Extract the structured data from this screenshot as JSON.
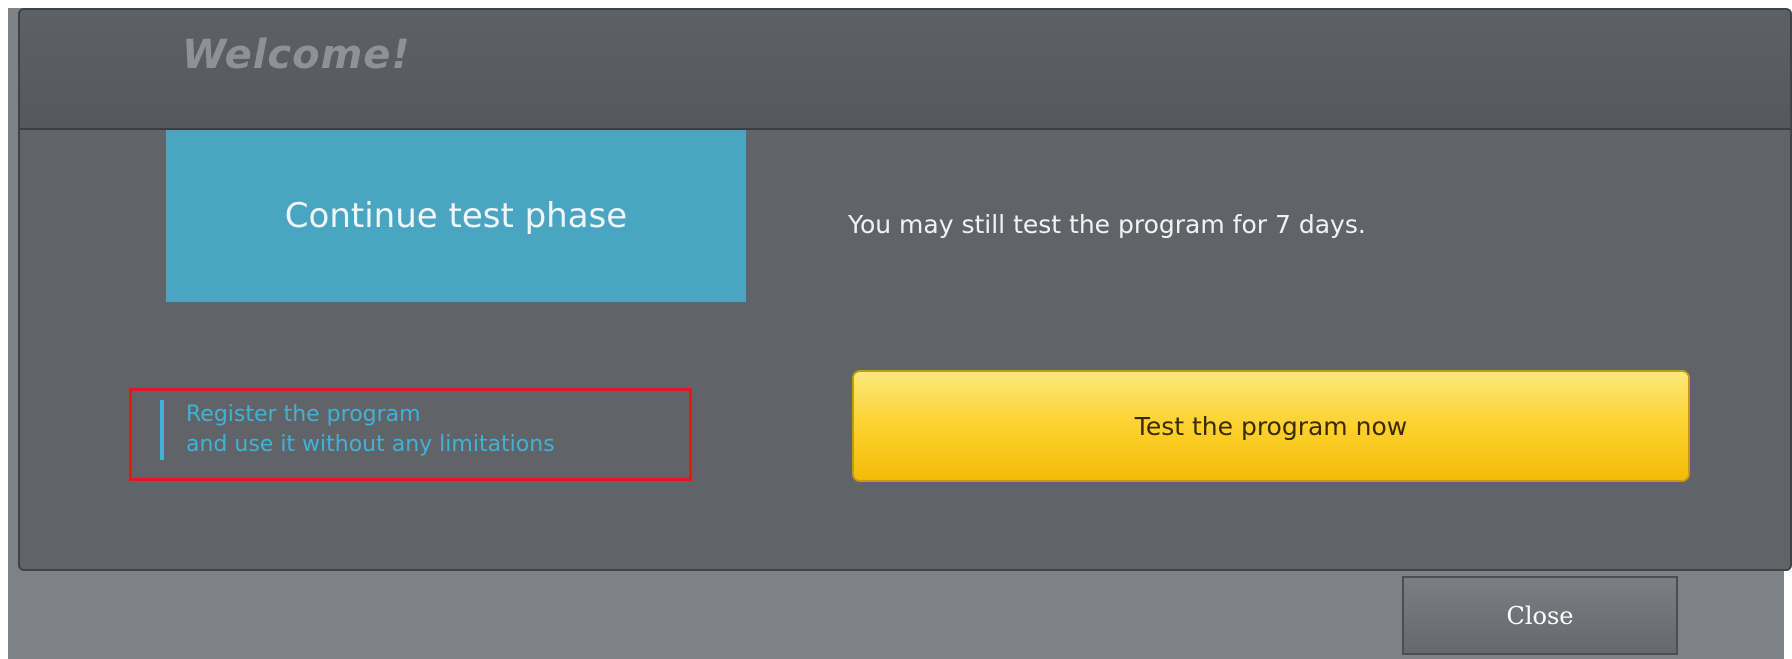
{
  "dialog": {
    "title": "Welcome!"
  },
  "continue_tile": {
    "label": "Continue test phase"
  },
  "info": {
    "text": "You may still test the program for 7 days."
  },
  "register_link": {
    "line1": "Register the program",
    "line2": "and use it without any limitations"
  },
  "test_button": {
    "label": "Test the program now"
  },
  "close_button": {
    "label": "Close"
  },
  "colors": {
    "accent_blue": "#4aa5c2",
    "link_blue": "#3fb2d6",
    "button_yellow": "#fcd12e",
    "highlight_red": "#e8161a"
  }
}
